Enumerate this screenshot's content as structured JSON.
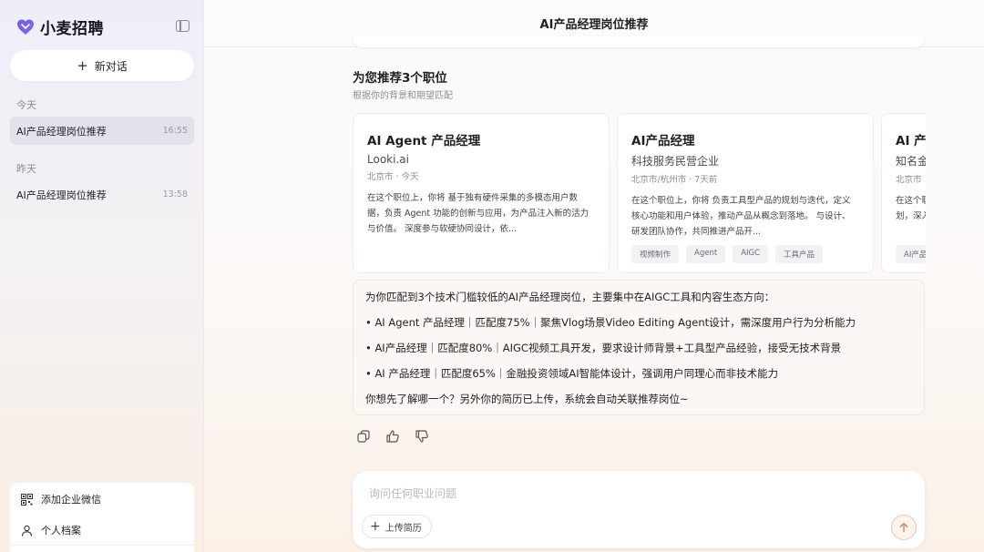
{
  "sidebar": {
    "brand": "小麦招聘",
    "new_chat": "新对话",
    "groups": [
      {
        "label": "今天",
        "items": [
          {
            "title": "AI产品经理岗位推荐",
            "time": "16:55"
          }
        ]
      },
      {
        "label": "昨天",
        "items": [
          {
            "title": "AI产品经理岗位推荐",
            "time": "13:58"
          }
        ]
      }
    ],
    "bottom_menu": [
      {
        "label": "添加企业微信",
        "icon": "qrcode-icon"
      },
      {
        "label": "个人档案",
        "icon": "user-icon"
      }
    ]
  },
  "main": {
    "title": "AI产品经理岗位推荐",
    "recommend": {
      "title": "为您推荐3个职位",
      "subtitle": "根据你的背景和期望匹配"
    },
    "jobs": [
      {
        "title": "AI Agent 产品经理",
        "company": "Looki.ai",
        "meta": "北京市 · 今天",
        "desc": "在这个职位上，你将 基于独有硬件采集的多模态用户数据，负责 Agent 功能的创新与应用，为产品注入新的活力与价值。 深度参与软硬协同设计，依...",
        "tags": []
      },
      {
        "title": "AI产品经理",
        "company": "科技服务民营企业",
        "meta": "北京市/杭州市 · 7天前",
        "desc": "在这个职位上，你将 负责工具型产品的规划与迭代，定义核心功能和用户体验，推动产品从概念到落地。 与设计、研发团队协作，共同推进产品开...",
        "tags": [
          "视频制作",
          "Agent",
          "AIGC",
          "工具产品"
        ]
      },
      {
        "title": "AI 产品经理",
        "company": "知名金融投资企业",
        "meta": "北京市",
        "desc": "在这个职位上，你将 负责金融投资领域的AI智能体设计与规划，深入理解用户需求，推动原型设计...",
        "tags": [
          "AI产品"
        ]
      }
    ],
    "answer": {
      "intro": "为你匹配到3个技术门槛较低的AI产品经理岗位，主要集中在AIGC工具和内容生态方向：",
      "bullets": [
        "• AI Agent 产品经理｜匹配度75%｜聚焦Vlog场景Video Editing Agent设计，需深度用户行为分析能力",
        "• AI产品经理｜匹配度80%｜AIGC视频工具开发，要求设计师背景+工具型产品经验，接受无技术背景",
        "• AI 产品经理｜匹配度65%｜金融投资领域AI智能体设计，强调用户同理心而非技术能力"
      ],
      "outro": "你想先了解哪一个？另外你的简历已上传，系统会自动关联推荐岗位~"
    },
    "composer": {
      "placeholder": "询问任何职业问题",
      "upload_label": "上传简历"
    }
  }
}
